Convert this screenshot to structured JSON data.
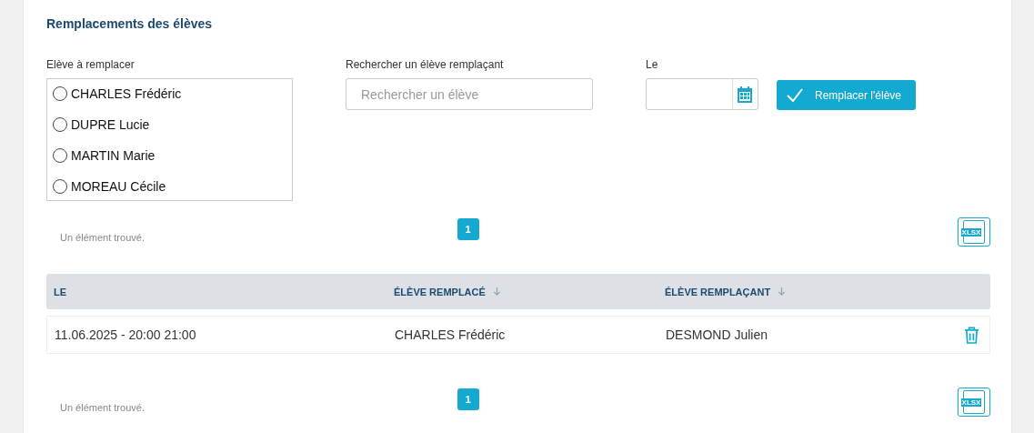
{
  "title": "Remplacements des élèves",
  "student_field": {
    "label": "Elève à remplacer",
    "options": [
      {
        "name": "CHARLES Frédéric",
        "selected": false
      },
      {
        "name": "DUPRE Lucie",
        "selected": false
      },
      {
        "name": "MARTIN Marie",
        "selected": false
      },
      {
        "name": "MOREAU Cécile",
        "selected": false
      }
    ]
  },
  "search_field": {
    "label": "Rechercher un élève remplaçant",
    "placeholder": "Rechercher un élève"
  },
  "date_field": {
    "label": "Le"
  },
  "submit_button": "Remplacer l'élève",
  "pager_top": {
    "count": "Un élément trouvé.",
    "pages": [
      {
        "label": "1",
        "selected": true
      }
    ],
    "export": "XLSX"
  },
  "table": {
    "columns": [
      {
        "label": "LE",
        "sortable": false
      },
      {
        "label": "ÉLÈVE REMPLACÉ",
        "sortable": true
      },
      {
        "label": "ÉLÈVE REMPLAÇANT",
        "sortable": true
      }
    ],
    "rows": [
      {
        "cells": [
          "11.06.2025 - 20:00 21:00",
          "CHARLES Frédéric",
          "DESMOND Julien"
        ]
      }
    ]
  },
  "pager_bottom": {
    "count": "Un élément trouvé.",
    "pages": [
      {
        "label": "1",
        "selected": true
      }
    ],
    "export": "XLSX"
  }
}
